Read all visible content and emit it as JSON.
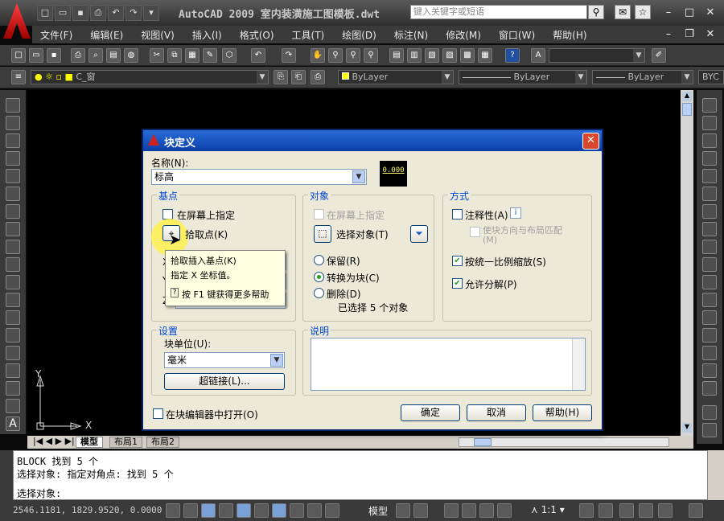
{
  "app": {
    "title": "AutoCAD 2009  室内装潢施工图模板.dwt",
    "search_placeholder": "键入关键字或短语"
  },
  "menu": [
    "文件(F)",
    "编辑(E)",
    "视图(V)",
    "插入(I)",
    "格式(O)",
    "工具(T)",
    "绘图(D)",
    "标注(N)",
    "修改(M)",
    "窗口(W)",
    "帮助(H)"
  ],
  "layers_bar": {
    "layer_name": "C_窗",
    "color": "ByLayer",
    "linetype": "ByLayer",
    "lineweight": "ByLayer",
    "plot_style": "BYC"
  },
  "dialog": {
    "title": "块定义",
    "name_label": "名称(N):",
    "name_value": "标高",
    "preview_text": "0.000",
    "base_point": {
      "group": "基点",
      "on_screen": "在屏幕上指定",
      "pick_point": "拾取点(K)",
      "x": "X",
      "y": "Y",
      "z": "Z"
    },
    "objects": {
      "group": "对象",
      "on_screen": "在屏幕上指定",
      "select_objects": "选择对象(T)",
      "retain": "保留(R)",
      "convert": "转换为块(C)",
      "delete": "删除(D)",
      "selected_count": "已选择 5 个对象"
    },
    "behavior": {
      "group": "方式",
      "annotative": "注释性(A)",
      "match_orient": "使块方向与布局匹配(M)",
      "scale_uniform": "按统一比例缩放(S)",
      "allow_explode": "允许分解(P)"
    },
    "settings": {
      "group": "设置",
      "unit_label": "块单位(U):",
      "unit_value": "毫米",
      "hyperlink": "超链接(L)..."
    },
    "description": {
      "group": "说明"
    },
    "open_in_editor": "在块编辑器中打开(O)",
    "ok": "确定",
    "cancel": "取消",
    "help": "帮助(H)"
  },
  "tooltip": {
    "title": "拾取插入基点(K)",
    "body": "指定 X 坐标值。",
    "f1": "按 F1 键获得更多帮助"
  },
  "layout_tabs": [
    "模型",
    "布局1",
    "布局2"
  ],
  "command": {
    "line1": "BLOCK 找到 5 个",
    "line2": "选择对象: 指定对角点: 找到 5 个",
    "prompt": "选择对象:"
  },
  "status": {
    "coords": "2546.1181, 1829.9520, 0.0000",
    "model": "模型",
    "scale": "1:1"
  },
  "ucs": {
    "x": "X",
    "y": "Y"
  }
}
